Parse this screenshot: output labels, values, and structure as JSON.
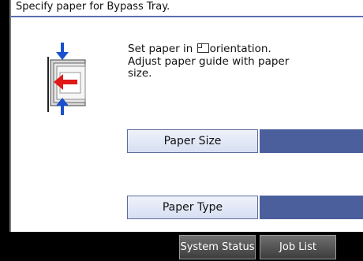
{
  "header": {
    "title": "Specify paper for Bypass Tray."
  },
  "instructions": {
    "line1_before": "Set paper in ",
    "orientation_icon": "landscape-orientation-icon",
    "line1_after": "orientation.",
    "line2": "Adjust paper guide with paper",
    "line3": "size."
  },
  "tray_illustration": {
    "icon": "bypass-tray-icon"
  },
  "fields": [
    {
      "label": "Paper Size",
      "value": ""
    },
    {
      "label": "Paper Type",
      "value": ""
    }
  ],
  "footer": {
    "system_status": "System Status",
    "job_list": "Job List"
  },
  "colors": {
    "accent_bar": "#4b5f9d",
    "arrow_blue": "#1a4fd0",
    "arrow_red": "#e01818",
    "header_line": "#5a6eb0"
  }
}
